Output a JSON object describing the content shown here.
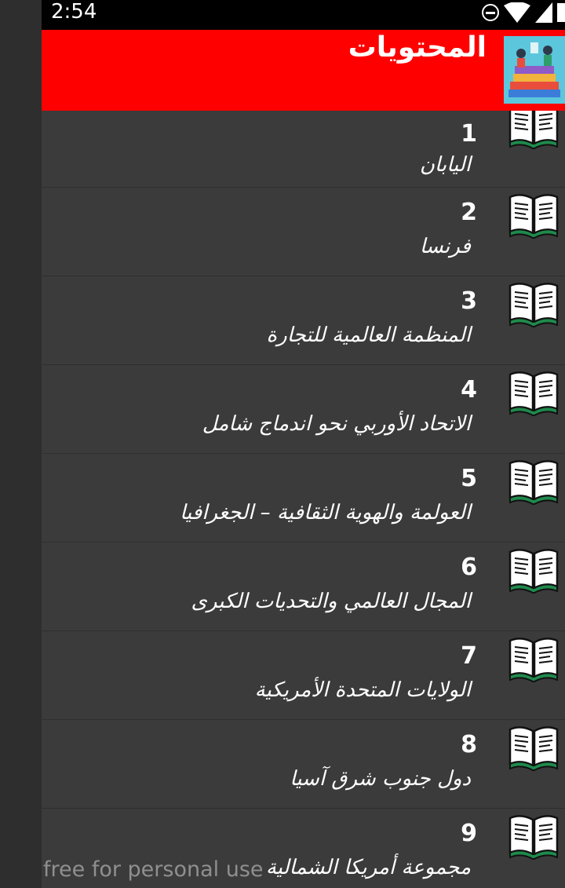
{
  "status_bar": {
    "time": "2:54"
  },
  "toolbar": {
    "title": "المحتويات"
  },
  "items": [
    {
      "number": "1",
      "title": "اليابان"
    },
    {
      "number": "2",
      "title": "فرنسا"
    },
    {
      "number": "3",
      "title": "المنظمة العالمية للتجارة"
    },
    {
      "number": "4",
      "title": "الاتحاد الأوربي نحو اندماج شامل"
    },
    {
      "number": "5",
      "title": "العولمة والهوية الثقافية – الجغرافيا"
    },
    {
      "number": "6",
      "title": "المجال العالمي والتحديات الكبرى"
    },
    {
      "number": "7",
      "title": "الولايات المتحدة الأمريكية"
    },
    {
      "number": "8",
      "title": "دول جنوب شرق آسيا"
    },
    {
      "number": "9",
      "title": "مجموعة أمريكا الشمالية"
    }
  ],
  "watermark": "free for personal use",
  "colors": {
    "toolbar": "#ff0000",
    "list_bg": "#3b3b3b",
    "book_green": "#1f8a4c"
  },
  "icons": {
    "row_icon": "open-book-icon",
    "app_logo": "books-illustration-logo"
  }
}
